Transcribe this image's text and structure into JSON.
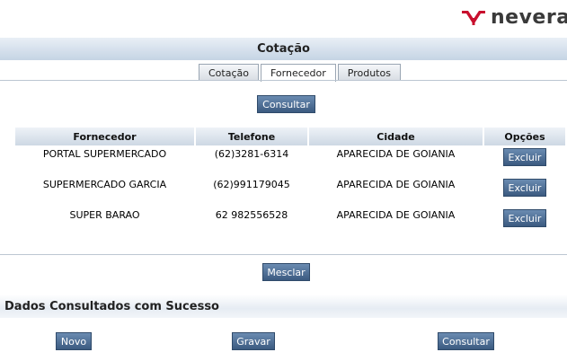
{
  "brand": {
    "name": "nevera"
  },
  "page": {
    "title": "Cotação"
  },
  "tabs": [
    {
      "label": "Cotação",
      "active": false
    },
    {
      "label": "Fornecedor",
      "active": true
    },
    {
      "label": "Produtos",
      "active": false
    }
  ],
  "actions": {
    "consultar_top": "Consultar",
    "mesclar": "Mesclar"
  },
  "table": {
    "headers": [
      "Fornecedor",
      "Telefone",
      "Cidade",
      "Opções"
    ],
    "rows": [
      {
        "fornecedor": "PORTAL SUPERMERCADO",
        "telefone": "(62)3281-6314",
        "cidade": "APARECIDA DE GOIANIA",
        "acao": "Excluir"
      },
      {
        "fornecedor": "SUPERMERCADO GARCIA",
        "telefone": "(62)991179045",
        "cidade": "APARECIDA DE GOIANIA",
        "acao": "Excluir"
      },
      {
        "fornecedor": "SUPER BARAO",
        "telefone": "62 982556528",
        "cidade": "APARECIDA DE GOIANIA",
        "acao": "Excluir"
      }
    ]
  },
  "status": {
    "message": "Dados Consultados com Sucesso"
  },
  "footer": {
    "novo": "Novo",
    "gravar": "Gravar",
    "consultar": "Consultar"
  },
  "colors": {
    "button": "#4a6b93",
    "header_bar": "#d5e0ec",
    "logo_red": "#c8102e"
  },
  "icons": {
    "logo": "nevera-logo-icon"
  }
}
